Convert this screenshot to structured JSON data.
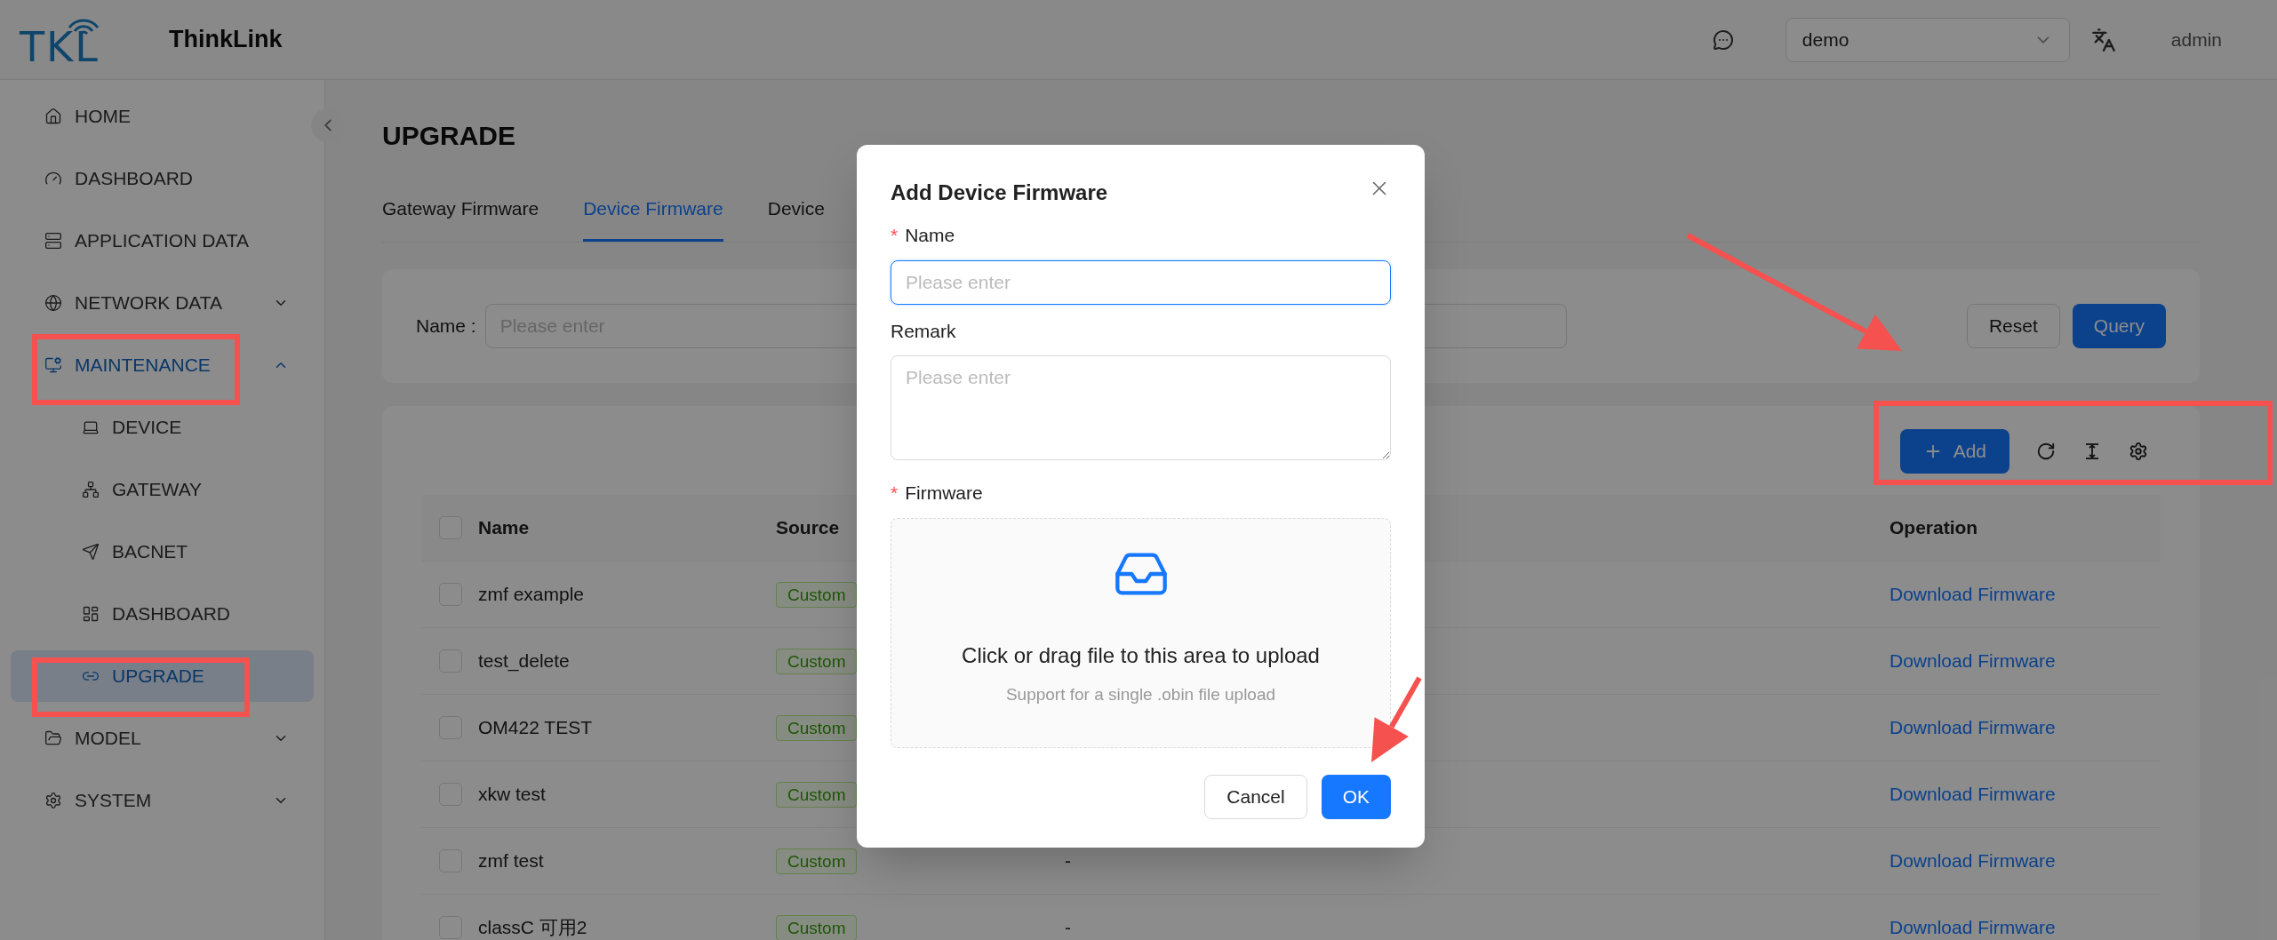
{
  "header": {
    "logo": "TKL",
    "app_name": "ThinkLink",
    "project": "demo",
    "user": "admin"
  },
  "sidebar": {
    "items": [
      {
        "label": "HOME",
        "kind": "link",
        "selected": false
      },
      {
        "label": "DASHBOARD",
        "kind": "link",
        "selected": false
      },
      {
        "label": "APPLICATION DATA",
        "kind": "link",
        "selected": false
      },
      {
        "label": "NETWORK DATA",
        "kind": "group",
        "expanded": false,
        "selected": false
      },
      {
        "label": "MAINTENANCE",
        "kind": "group",
        "expanded": true,
        "selected": true,
        "children": [
          {
            "label": "DEVICE",
            "selected": false
          },
          {
            "label": "GATEWAY",
            "selected": false
          },
          {
            "label": "BACNET",
            "selected": false
          },
          {
            "label": "DASHBOARD",
            "selected": false
          },
          {
            "label": "UPGRADE",
            "selected": true
          }
        ]
      },
      {
        "label": "MODEL",
        "kind": "group",
        "expanded": false,
        "selected": false
      },
      {
        "label": "SYSTEM",
        "kind": "group",
        "expanded": false,
        "selected": false
      }
    ]
  },
  "page": {
    "title": "UPGRADE",
    "tabs": [
      {
        "label": "Gateway Firmware",
        "selected": false
      },
      {
        "label": "Device Firmware",
        "selected": true
      },
      {
        "label": "Device",
        "selected": false
      }
    ],
    "filter": {
      "label": "Name :",
      "placeholder": "Please enter",
      "buttons": [
        {
          "label": "Reset",
          "kind": "default"
        },
        {
          "label": "Query",
          "kind": "primary"
        }
      ]
    },
    "toolbar": {
      "add_button": "Add"
    },
    "table": {
      "select_all_checked": false,
      "columns": [
        "Name",
        "Source",
        "Operation"
      ],
      "rows": [
        {
          "checked": false,
          "name": "zmf example",
          "source": "Custom",
          "operation": "Download Firmware"
        },
        {
          "checked": false,
          "name": "test_delete",
          "source": "Custom",
          "operation": "Download Firmware"
        },
        {
          "checked": false,
          "name": "OM422 TEST",
          "source": "Custom",
          "operation": "Download Firmware"
        },
        {
          "checked": false,
          "name": "xkw test",
          "source": "Custom",
          "operation": "Download Firmware"
        },
        {
          "checked": false,
          "name": "zmf test",
          "source": "Custom",
          "column_3": "-",
          "operation": "Download Firmware"
        },
        {
          "checked": false,
          "name": "classC 可用2",
          "source": "Custom",
          "column_3": "-",
          "operation": "Download Firmware"
        }
      ]
    }
  },
  "dialog": {
    "title": "Add Device Firmware",
    "fields": [
      {
        "kind": "input",
        "label": "Name",
        "required_mark": "*",
        "placeholder": "Please enter",
        "focused": true
      },
      {
        "kind": "textarea",
        "label": "Remark",
        "placeholder": "Please enter",
        "focused": false
      },
      {
        "kind": "upload",
        "label": "Firmware",
        "required_mark": "*",
        "text": "Click or drag file to this area to upload",
        "hint": "Support for a single .obin file upload"
      }
    ],
    "buttons": [
      {
        "label": "Cancel",
        "kind": "default"
      },
      {
        "label": "OK",
        "kind": "primary"
      }
    ]
  }
}
